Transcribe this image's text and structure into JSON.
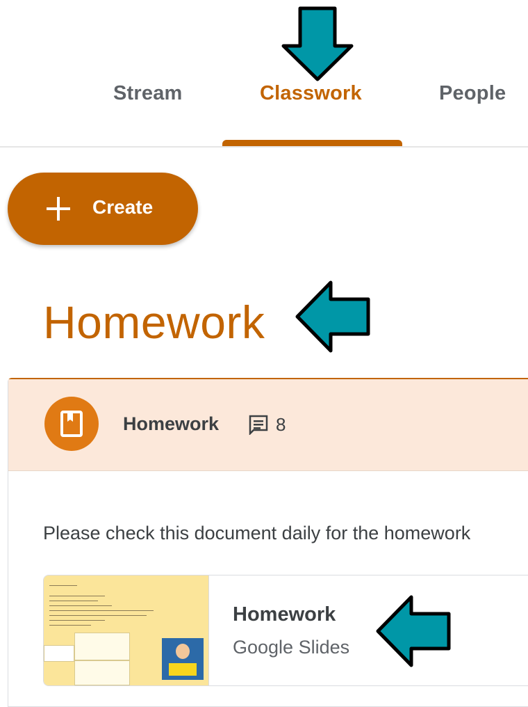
{
  "tabs": {
    "stream": "Stream",
    "classwork": "Classwork",
    "people": "People",
    "active": "Classwork"
  },
  "toolbar": {
    "create_label": "Create",
    "create_icon": "plus-icon"
  },
  "topic": {
    "title": "Homework"
  },
  "assignment": {
    "icon": "assignment-icon",
    "title": "Homework",
    "comment_icon": "comment-icon",
    "comment_count": "8",
    "description": "Please check this document daily for the homework",
    "attachment": {
      "thumbnail_icon": "slides-thumbnail",
      "title": "Homework",
      "type": "Google Slides"
    }
  },
  "annotations": {
    "arrow_icon": "pointer-arrow-icon",
    "color": "#0097a7"
  },
  "colors": {
    "accent": "#c26401",
    "header_bg": "#fce8da",
    "assignment_icon_bg": "#e07a14"
  }
}
